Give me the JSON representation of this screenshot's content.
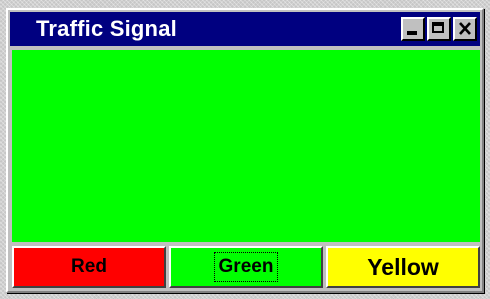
{
  "window": {
    "title": "Traffic Signal"
  },
  "title_controls": [
    {
      "icon": "minimize-icon"
    },
    {
      "icon": "maximize-icon"
    },
    {
      "icon": "close-icon"
    }
  ],
  "signal": {
    "current_color": "#00ff00"
  },
  "buttons": {
    "red_label": "Red",
    "red_color": "#ff0000",
    "green_label": "Green",
    "green_color": "#00ff00",
    "yellow_label": "Yellow",
    "yellow_color": "#ffff00",
    "focused": "Green"
  },
  "colors": {
    "titlebar": "#000080",
    "chrome": "#c0c0c0"
  }
}
